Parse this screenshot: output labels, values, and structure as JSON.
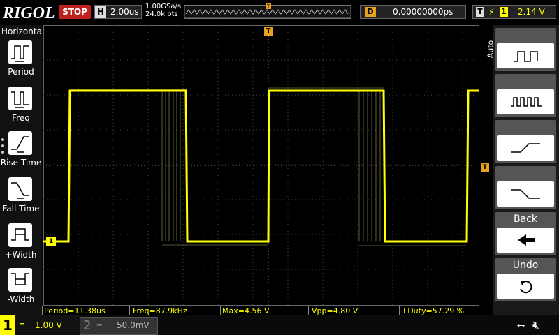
{
  "brand": "RIGOL",
  "run_state": "STOP",
  "horizontal": {
    "label": "H",
    "timebase": "2.00us",
    "sample_rate": "1.00GSa/s",
    "memory": "24.0k pts"
  },
  "delay": {
    "label": "D",
    "value": "0.00000000ps"
  },
  "trigger": {
    "label": "T",
    "channel": "1",
    "level": "2.14 V"
  },
  "left_menu": {
    "title": "Horizontal",
    "items": [
      {
        "label": "Period",
        "icon": "period-icon"
      },
      {
        "label": "Freq",
        "icon": "frequency-icon"
      },
      {
        "label": "Rise Time",
        "icon": "rise-time-icon"
      },
      {
        "label": "Fall Time",
        "icon": "fall-time-icon"
      },
      {
        "label": "+Width",
        "icon": "positive-width-icon"
      },
      {
        "label": "-Width",
        "icon": "negative-width-icon"
      }
    ]
  },
  "right_menu": {
    "mode": "Auto",
    "buttons": [
      {
        "icon": "single-pulse-wave-icon"
      },
      {
        "icon": "pulse-train-wave-icon"
      },
      {
        "icon": "rising-edge-icon"
      },
      {
        "icon": "falling-edge-icon"
      },
      {
        "label": "Back",
        "icon": "left-arrow-icon"
      },
      {
        "label": "Undo",
        "icon": "undo-icon"
      }
    ]
  },
  "markers": {
    "trigger_pos": "T",
    "channel1": "1"
  },
  "measurements": [
    "Period=11.38us",
    "Freq=87.9kHz",
    "Max=4.56 V",
    "Vpp=4.80 V",
    "+Duty=57.29 %"
  ],
  "channels": [
    {
      "number": "1",
      "scale": "1.00 V",
      "color": "#ffff00"
    },
    {
      "number": "2",
      "scale": "50.0mV",
      "color": "#00c0ff"
    }
  ],
  "colors": {
    "trace": "#ffff00",
    "trigger_marker": "#e8a020",
    "stop": "#c02020"
  }
}
